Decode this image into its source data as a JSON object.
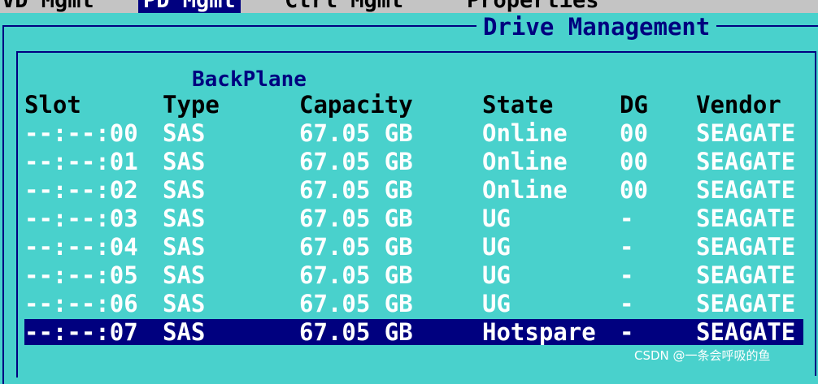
{
  "tabs": [
    {
      "label": "VD Mgmt"
    },
    {
      "label": "PD Mgmt",
      "active": true
    },
    {
      "label": "Ctrl Mgmt"
    },
    {
      "label": "Properties"
    }
  ],
  "panel": {
    "title": "Drive Management",
    "section_title": "BackPlane"
  },
  "columns": {
    "slot": "Slot",
    "type": "Type",
    "capacity": "Capacity",
    "state": "State",
    "dg": "DG",
    "vendor": "Vendor"
  },
  "rows": [
    {
      "slot": "--:--:00",
      "type": "SAS",
      "capacity": "67.05 GB",
      "state": "Online",
      "dg": "00",
      "vendor": "SEAGATE"
    },
    {
      "slot": "--:--:01",
      "type": "SAS",
      "capacity": "67.05 GB",
      "state": "Online",
      "dg": "00",
      "vendor": "SEAGATE"
    },
    {
      "slot": "--:--:02",
      "type": "SAS",
      "capacity": "67.05 GB",
      "state": "Online",
      "dg": "00",
      "vendor": "SEAGATE"
    },
    {
      "slot": "--:--:03",
      "type": "SAS",
      "capacity": "67.05 GB",
      "state": "UG",
      "dg": "-",
      "vendor": "SEAGATE"
    },
    {
      "slot": "--:--:04",
      "type": "SAS",
      "capacity": "67.05 GB",
      "state": "UG",
      "dg": "-",
      "vendor": "SEAGATE"
    },
    {
      "slot": "--:--:05",
      "type": "SAS",
      "capacity": "67.05 GB",
      "state": "UG",
      "dg": "-",
      "vendor": "SEAGATE"
    },
    {
      "slot": "--:--:06",
      "type": "SAS",
      "capacity": "67.05 GB",
      "state": "UG",
      "dg": "-",
      "vendor": "SEAGATE"
    },
    {
      "slot": "--:--:07",
      "type": "SAS",
      "capacity": "67.05 GB",
      "state": "Hotspare",
      "dg": "-",
      "vendor": "SEAGATE",
      "selected": true
    }
  ],
  "watermark": "CSDN @一条会呼吸的鱼",
  "colors": {
    "background": "#49d1cc",
    "frame": "#000080",
    "selection": "#00007f",
    "row_text": "#ffffff",
    "tabbar": "#c4c4c4"
  }
}
